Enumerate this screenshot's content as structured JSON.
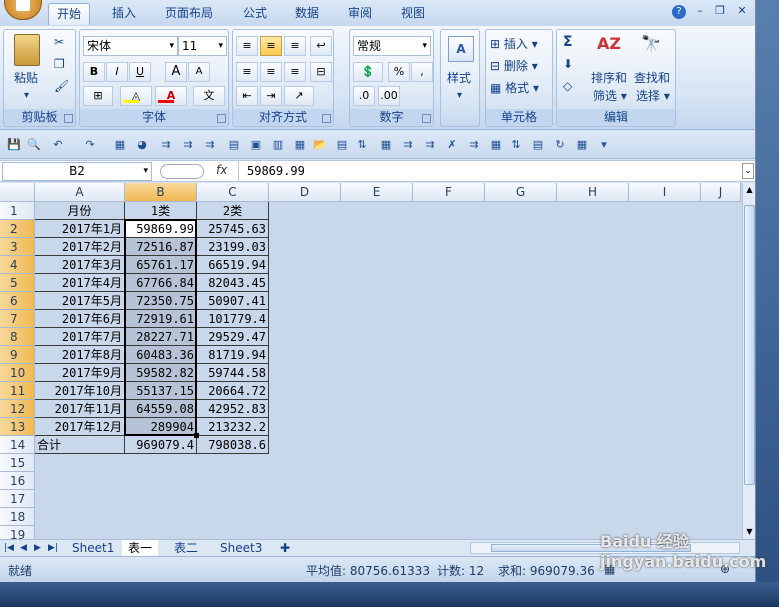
{
  "ribbon_tabs": [
    "开始",
    "插入",
    "页面布局",
    "公式",
    "数据",
    "审阅",
    "视图"
  ],
  "clipboard": {
    "paste": "粘贴",
    "label": "剪贴板"
  },
  "font": {
    "name": "宋体",
    "size": "11",
    "label": "字体",
    "bold": "B",
    "italic": "I",
    "underline": "U",
    "grow": "A",
    "shrink": "A",
    "fontcolor": "A",
    "phonetic": "文"
  },
  "align": {
    "label": "对齐方式"
  },
  "number": {
    "format": "常规",
    "label": "数字",
    "percent": "%",
    "comma": ","
  },
  "styles": {
    "label": "样式"
  },
  "cells": {
    "insert": "插入",
    "delete": "删除",
    "format": "格式",
    "label": "单元格"
  },
  "editing": {
    "sort": "排序和\n筛选",
    "find": "查找和\n选择",
    "sortA": "排序和",
    "sortB": "筛选",
    "findA": "查找和",
    "findB": "选择",
    "label": "编辑",
    "sigma": "Σ"
  },
  "formula_bar": {
    "cell_ref": "B2",
    "fx": "fx",
    "value": "59869.99"
  },
  "columns": [
    "A",
    "B",
    "C",
    "D",
    "E",
    "F",
    "G",
    "H",
    "I",
    "J"
  ],
  "rows": [
    "1",
    "2",
    "3",
    "4",
    "5",
    "6",
    "7",
    "8",
    "9",
    "10",
    "11",
    "12",
    "13",
    "14",
    "15",
    "16",
    "17",
    "18",
    "19"
  ],
  "table": [
    [
      "月份",
      "1类",
      "2类"
    ],
    [
      "2017年1月",
      "59869.99",
      "25745.63"
    ],
    [
      "2017年2月",
      "72516.87",
      "23199.03"
    ],
    [
      "2017年3月",
      "65761.17",
      "66519.94"
    ],
    [
      "2017年4月",
      "67766.84",
      "82043.45"
    ],
    [
      "2017年5月",
      "72350.75",
      "50907.41"
    ],
    [
      "2017年6月",
      "72919.61",
      "101779.4"
    ],
    [
      "2017年7月",
      "28227.71",
      "29529.47"
    ],
    [
      "2017年8月",
      "60483.36",
      "81719.94"
    ],
    [
      "2017年9月",
      "59582.82",
      "59744.58"
    ],
    [
      "2017年10月",
      "55137.15",
      "20664.72"
    ],
    [
      "2017年11月",
      "64559.08",
      "42952.83"
    ],
    [
      "2017年12月",
      "289904",
      "213232.2"
    ],
    [
      "合计",
      "969079.4",
      "798038.6"
    ]
  ],
  "sheets": [
    "Sheet1",
    "表一",
    "表二",
    "Sheet3"
  ],
  "status": {
    "ready": "就绪",
    "average": "平均值: 80756.61333",
    "count": "计数: 12",
    "sum": "求和: 969079.36"
  },
  "watermark": "Baidu 经验 jingyan.baidu.com"
}
